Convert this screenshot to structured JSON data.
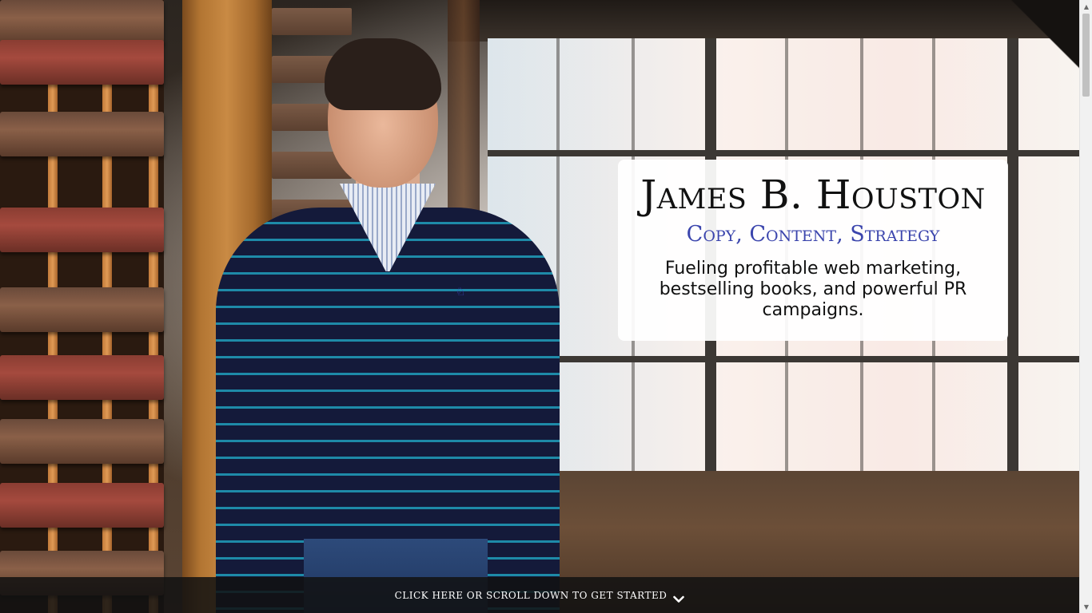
{
  "hero": {
    "name": "James B. Houston",
    "tagline": "Copy, Content, Strategy",
    "description": "Fueling profitable web marketing, bestselling books, and powerful PR campaigns."
  },
  "cta": {
    "label": "Click here or scroll down to get started",
    "icon": "chevron-down-icon"
  },
  "colors": {
    "tagline": "#3b45ad",
    "cta_bar": "#121212"
  }
}
